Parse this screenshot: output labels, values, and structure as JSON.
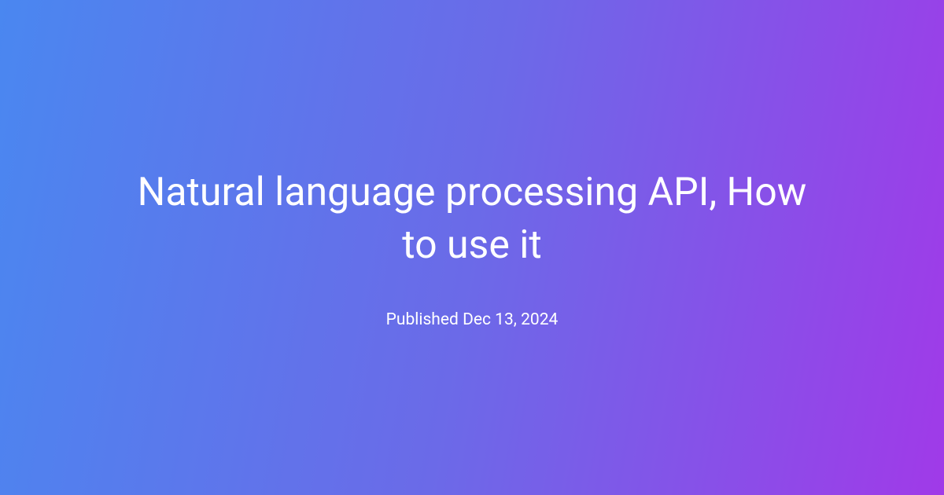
{
  "hero": {
    "title": "Natural language processing API, How to use it",
    "published": "Published Dec 13, 2024"
  }
}
